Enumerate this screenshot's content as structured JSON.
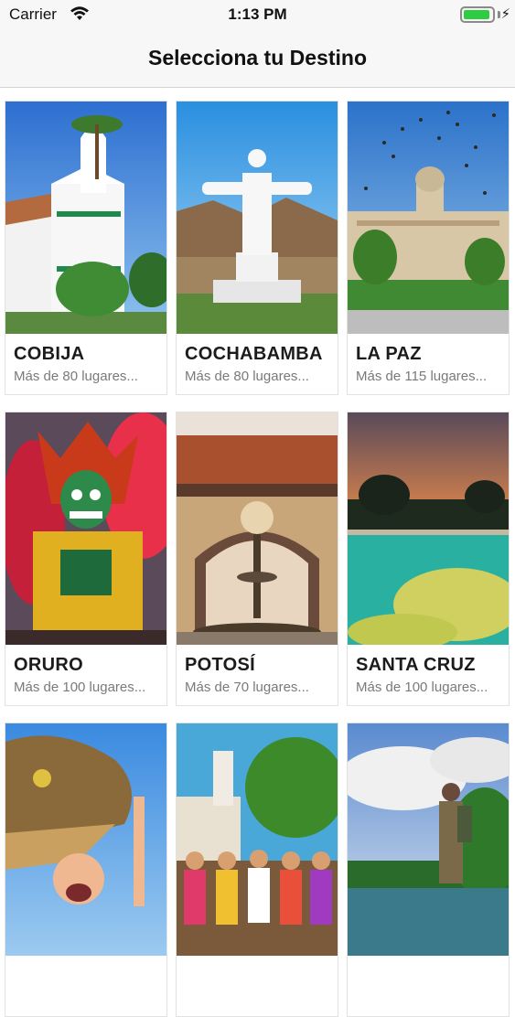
{
  "status": {
    "carrier": "Carrier",
    "time": "1:13 PM"
  },
  "nav": {
    "title": "Selecciona tu Destino"
  },
  "destinations": [
    {
      "name": "COBIJA",
      "subtitle": "Más de 80 lugares..."
    },
    {
      "name": "COCHABAMBA",
      "subtitle": "Más de 80 lugares..."
    },
    {
      "name": "LA PAZ",
      "subtitle": "Más de 115 lugares..."
    },
    {
      "name": "ORURO",
      "subtitle": "Más de 100 lugares..."
    },
    {
      "name": "POTOSÍ",
      "subtitle": "Más de 70 lugares..."
    },
    {
      "name": "SANTA CRUZ",
      "subtitle": "Más de 100 lugares..."
    },
    {
      "name": "",
      "subtitle": ""
    },
    {
      "name": "",
      "subtitle": ""
    },
    {
      "name": "",
      "subtitle": ""
    }
  ],
  "colors": {
    "battery": "#2ecc40",
    "title": "#1c1c1c",
    "subtitle": "#7a7a7a"
  }
}
